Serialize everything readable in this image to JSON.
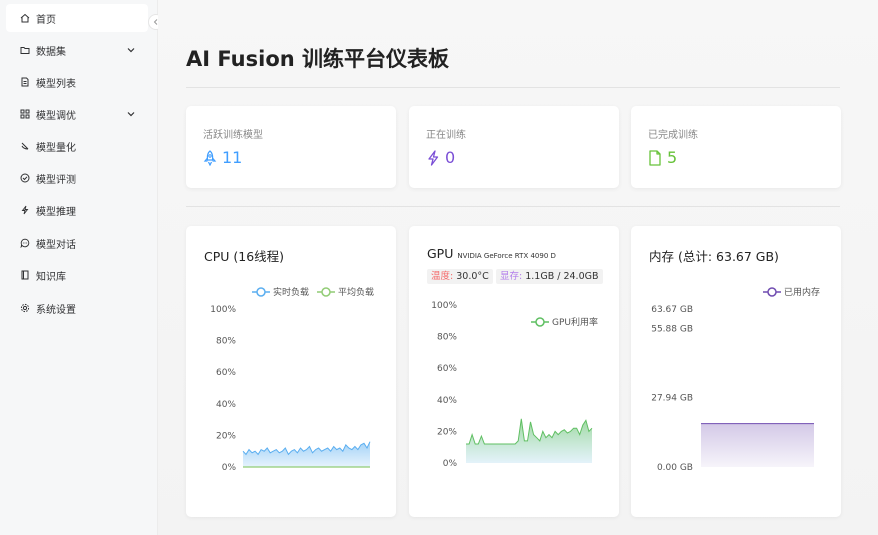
{
  "sidebar": {
    "collapse_icon": "chevron-left-icon",
    "items": [
      {
        "label": "首页",
        "icon": "home-icon",
        "active": true,
        "expandable": false
      },
      {
        "label": "数据集",
        "icon": "folder-icon",
        "active": false,
        "expandable": true
      },
      {
        "label": "模型列表",
        "icon": "document-icon",
        "active": false,
        "expandable": false
      },
      {
        "label": "模型调优",
        "icon": "grid-icon",
        "active": false,
        "expandable": true
      },
      {
        "label": "模型量化",
        "icon": "scale-icon",
        "active": false,
        "expandable": false
      },
      {
        "label": "模型评测",
        "icon": "check-circle-icon",
        "active": false,
        "expandable": false
      },
      {
        "label": "模型推理",
        "icon": "lightning-icon",
        "active": false,
        "expandable": false
      },
      {
        "label": "模型对话",
        "icon": "chat-icon",
        "active": false,
        "expandable": false
      },
      {
        "label": "知识库",
        "icon": "book-icon",
        "active": false,
        "expandable": false
      },
      {
        "label": "系统设置",
        "icon": "gear-icon",
        "active": false,
        "expandable": false
      }
    ]
  },
  "header": {
    "title": "AI Fusion 训练平台仪表板"
  },
  "stats": [
    {
      "label": "活跃训练模型",
      "value": "11",
      "icon": "rocket-icon",
      "color": "#409eff"
    },
    {
      "label": "正在训练",
      "value": "0",
      "icon": "lightning-icon",
      "color": "#7b4fd6"
    },
    {
      "label": "已完成训练",
      "value": "5",
      "icon": "document-icon",
      "color": "#67c23a"
    }
  ],
  "cpu": {
    "title": "CPU (16线程)"
  },
  "gpu": {
    "title": "GPU",
    "model": "NVIDIA GeForce RTX 4090 D",
    "temp_label": "温度:",
    "temp_value": "30.0°C",
    "mem_label": "显存:",
    "mem_value": "1.1GB / 24.0GB"
  },
  "memory": {
    "title": "内存 (总计: 63.67 GB)"
  },
  "chart_data": [
    {
      "type": "area",
      "name": "cpu",
      "yticks": [
        "100%",
        "80%",
        "60%",
        "40%",
        "20%",
        "0%"
      ],
      "ylim": [
        0,
        100
      ],
      "legend_position": "top-right",
      "series": [
        {
          "name": "实时负载",
          "color": "#5aaef0",
          "values": [
            10,
            8,
            11,
            9,
            10,
            8,
            11,
            10,
            12,
            9,
            10,
            11,
            9,
            10,
            12,
            8,
            10,
            11,
            9,
            12,
            10,
            11,
            13,
            9,
            11,
            12,
            10,
            11,
            12,
            10,
            13,
            11,
            12,
            10,
            14,
            12,
            11,
            13,
            11,
            14,
            15,
            12,
            16
          ]
        },
        {
          "name": "平均负载",
          "color": "#91cc75",
          "values": [
            0,
            0,
            0,
            0,
            0,
            0,
            0,
            0,
            0,
            0,
            0,
            0,
            0,
            0,
            0,
            0,
            0,
            0,
            0,
            0,
            0,
            0,
            0,
            0,
            0,
            0,
            0,
            0,
            0,
            0,
            0,
            0,
            0,
            0,
            0,
            0,
            0,
            0,
            0,
            0,
            0,
            0,
            0
          ]
        }
      ]
    },
    {
      "type": "area",
      "name": "gpu",
      "yticks": [
        "100%",
        "80%",
        "60%",
        "40%",
        "20%",
        "0%"
      ],
      "ylim": [
        0,
        100
      ],
      "legend_position": "top-right",
      "series": [
        {
          "name": "GPU利用率",
          "color": "#5fbf62",
          "values": [
            12,
            12,
            18,
            12,
            12,
            17,
            12,
            12,
            12,
            12,
            12,
            12,
            12,
            12,
            12,
            12,
            12,
            14,
            28,
            14,
            14,
            26,
            18,
            16,
            14,
            20,
            16,
            18,
            16,
            20,
            18,
            20,
            21,
            19,
            20,
            22,
            22,
            18,
            24,
            27,
            20,
            22
          ]
        }
      ]
    },
    {
      "type": "area",
      "name": "memory",
      "yticks": [
        "63.67 GB",
        "55.88 GB",
        "27.94 GB",
        "0.00 GB"
      ],
      "ylim": [
        0,
        63.67
      ],
      "legend_position": "top-right",
      "series": [
        {
          "name": "已用内存",
          "color": "#6f4bb0",
          "values": [
            17.5,
            17.5
          ]
        }
      ]
    }
  ]
}
